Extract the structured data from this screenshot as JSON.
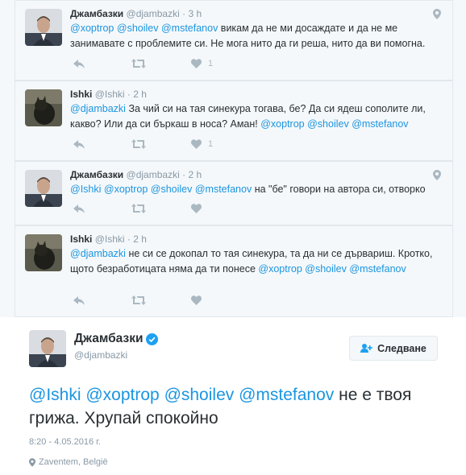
{
  "thread": [
    {
      "name": "Джамбазки",
      "handle": "@djambazki",
      "dot": "·",
      "time": "3 h",
      "has_geo": true,
      "text_parts": [
        {
          "t": "@xoptrop",
          "m": true
        },
        {
          "t": " ",
          "m": false
        },
        {
          "t": "@shoilev",
          "m": true
        },
        {
          "t": " ",
          "m": false
        },
        {
          "t": "@mstefanov",
          "m": true
        },
        {
          "t": " викам да не ми досаждате и да не ме занимавате с проблемите си. Не мога нито да ги реша, нито да ви помогна.",
          "m": false
        }
      ],
      "like_count": "1"
    },
    {
      "name": "Ishki",
      "handle": "@Ishki",
      "dot": "·",
      "time": "2 h",
      "has_geo": false,
      "text_parts": [
        {
          "t": "@djambazki",
          "m": true
        },
        {
          "t": " За чий си на тая синекура тогава, бе? Да си ядеш сополите ли, какво? Или да си бъркаш в носа? Аман! ",
          "m": false
        },
        {
          "t": "@xoptrop",
          "m": true
        },
        {
          "t": " ",
          "m": false
        },
        {
          "t": "@shoilev",
          "m": true
        },
        {
          "t": " ",
          "m": false
        },
        {
          "t": "@mstefanov",
          "m": true
        }
      ],
      "like_count": "1"
    },
    {
      "name": "Джамбазки",
      "handle": "@djambazki",
      "dot": "·",
      "time": "2 h",
      "has_geo": true,
      "text_parts": [
        {
          "t": "@Ishki",
          "m": true
        },
        {
          "t": " ",
          "m": false
        },
        {
          "t": "@xoptrop",
          "m": true
        },
        {
          "t": " ",
          "m": false
        },
        {
          "t": "@shoilev",
          "m": true
        },
        {
          "t": " ",
          "m": false
        },
        {
          "t": "@mstefanov",
          "m": true
        },
        {
          "t": " на \"бе\" говори на автора си, отворко",
          "m": false
        }
      ],
      "like_count": ""
    },
    {
      "name": "Ishki",
      "handle": "@Ishki",
      "dot": "·",
      "time": "2 h",
      "has_geo": false,
      "text_parts": [
        {
          "t": "@djambazki",
          "m": true
        },
        {
          "t": " не си се докопал то тая синекура, та да ни се дървариш. Кротко, щото безработицата няма да ти понесе ",
          "m": false
        },
        {
          "t": "@xoptrop",
          "m": true
        },
        {
          "t": " ",
          "m": false
        },
        {
          "t": "@shoilev",
          "m": true
        },
        {
          "t": " ",
          "m": false
        },
        {
          "t": "@mstefanov",
          "m": true
        }
      ],
      "like_count": ""
    }
  ],
  "main": {
    "name": "Джамбазки",
    "handle": "@djambazki",
    "follow_label": "Следване",
    "text_parts": [
      {
        "t": "@Ishki",
        "m": true
      },
      {
        "t": " ",
        "m": false
      },
      {
        "t": "@xoptrop",
        "m": true
      },
      {
        "t": " ",
        "m": false
      },
      {
        "t": "@shoilev",
        "m": true
      },
      {
        "t": " ",
        "m": false
      },
      {
        "t": "@mstefanov",
        "m": true
      },
      {
        "t": " не е твоя грижа. Хрупай спокойно",
        "m": false
      }
    ],
    "timestamp": "8:20 - 4.05.2016 г.",
    "location": "Zaventem, België"
  },
  "colors": {
    "mention": "#1b95e0",
    "verified": "#1da1f2",
    "muted": "#8899a6",
    "icon": "#aab8c2"
  },
  "icons": [
    "reply-icon",
    "retweet-icon",
    "like-icon",
    "geo-pin-icon",
    "verified-badge-icon",
    "follow-person-icon"
  ]
}
